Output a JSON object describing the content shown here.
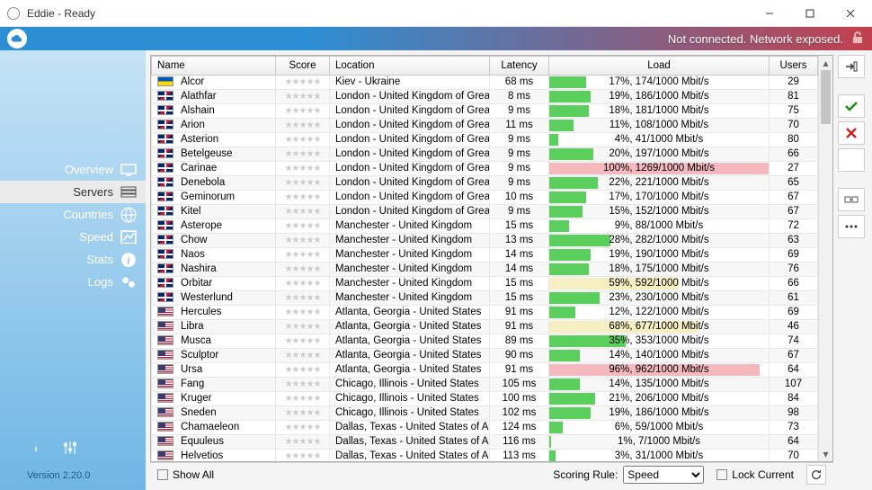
{
  "window": {
    "title": "Eddie - Ready"
  },
  "status": {
    "text": "Not connected. Network exposed."
  },
  "sidebar": {
    "items": [
      {
        "label": "Overview"
      },
      {
        "label": "Servers"
      },
      {
        "label": "Countries"
      },
      {
        "label": "Speed"
      },
      {
        "label": "Stats"
      },
      {
        "label": "Logs"
      }
    ],
    "version": "Version 2.20.0"
  },
  "table": {
    "headers": {
      "name": "Name",
      "score": "Score",
      "location": "Location",
      "latency": "Latency",
      "load": "Load",
      "users": "Users"
    },
    "rows": [
      {
        "flag": "ua",
        "name": "Alcor",
        "location": "Kiev - Ukraine",
        "latency": "68 ms",
        "load_pct": 17,
        "load_text": "17%, 174/1000 Mbit/s",
        "users": 29,
        "color": "green"
      },
      {
        "flag": "gb",
        "name": "Alathfar",
        "location": "London - United Kingdom of Great Britain",
        "latency": "8 ms",
        "load_pct": 19,
        "load_text": "19%, 186/1000 Mbit/s",
        "users": 81,
        "color": "green"
      },
      {
        "flag": "gb",
        "name": "Alshain",
        "location": "London - United Kingdom of Great Britain",
        "latency": "9 ms",
        "load_pct": 18,
        "load_text": "18%, 181/1000 Mbit/s",
        "users": 75,
        "color": "green"
      },
      {
        "flag": "gb",
        "name": "Arion",
        "location": "London - United Kingdom of Great Britain",
        "latency": "11 ms",
        "load_pct": 11,
        "load_text": "11%, 108/1000 Mbit/s",
        "users": 70,
        "color": "green"
      },
      {
        "flag": "gb",
        "name": "Asterion",
        "location": "London - United Kingdom of Great Britain",
        "latency": "9 ms",
        "load_pct": 4,
        "load_text": "4%, 41/1000 Mbit/s",
        "users": 80,
        "color": "green"
      },
      {
        "flag": "gb",
        "name": "Betelgeuse",
        "location": "London - United Kingdom of Great Britain",
        "latency": "9 ms",
        "load_pct": 20,
        "load_text": "20%, 197/1000 Mbit/s",
        "users": 66,
        "color": "green"
      },
      {
        "flag": "gb",
        "name": "Carinae",
        "location": "London - United Kingdom of Great Britain",
        "latency": "9 ms",
        "load_pct": 100,
        "load_text": "100%, 1269/1000 Mbit/s",
        "users": 27,
        "color": "red"
      },
      {
        "flag": "gb",
        "name": "Denebola",
        "location": "London - United Kingdom of Great Britain",
        "latency": "9 ms",
        "load_pct": 22,
        "load_text": "22%, 221/1000 Mbit/s",
        "users": 65,
        "color": "green"
      },
      {
        "flag": "gb",
        "name": "Geminorum",
        "location": "London - United Kingdom of Great Britain",
        "latency": "10 ms",
        "load_pct": 17,
        "load_text": "17%, 170/1000 Mbit/s",
        "users": 67,
        "color": "green"
      },
      {
        "flag": "gb",
        "name": "Kitel",
        "location": "London - United Kingdom of Great Britain",
        "latency": "9 ms",
        "load_pct": 15,
        "load_text": "15%, 152/1000 Mbit/s",
        "users": 67,
        "color": "green"
      },
      {
        "flag": "gb",
        "name": "Asterope",
        "location": "Manchester - United Kingdom",
        "latency": "15 ms",
        "load_pct": 9,
        "load_text": "9%, 88/1000 Mbit/s",
        "users": 72,
        "color": "green"
      },
      {
        "flag": "gb",
        "name": "Chow",
        "location": "Manchester - United Kingdom",
        "latency": "13 ms",
        "load_pct": 28,
        "load_text": "28%, 282/1000 Mbit/s",
        "users": 63,
        "color": "green"
      },
      {
        "flag": "gb",
        "name": "Naos",
        "location": "Manchester - United Kingdom",
        "latency": "14 ms",
        "load_pct": 19,
        "load_text": "19%, 190/1000 Mbit/s",
        "users": 69,
        "color": "green"
      },
      {
        "flag": "gb",
        "name": "Nashira",
        "location": "Manchester - United Kingdom",
        "latency": "14 ms",
        "load_pct": 18,
        "load_text": "18%, 175/1000 Mbit/s",
        "users": 76,
        "color": "green"
      },
      {
        "flag": "gb",
        "name": "Orbitar",
        "location": "Manchester - United Kingdom",
        "latency": "15 ms",
        "load_pct": 59,
        "load_text": "59%, 592/1000 Mbit/s",
        "users": 66,
        "color": "yellow"
      },
      {
        "flag": "gb",
        "name": "Westerlund",
        "location": "Manchester - United Kingdom",
        "latency": "15 ms",
        "load_pct": 23,
        "load_text": "23%, 230/1000 Mbit/s",
        "users": 61,
        "color": "green"
      },
      {
        "flag": "us",
        "name": "Hercules",
        "location": "Atlanta, Georgia - United States",
        "latency": "91 ms",
        "load_pct": 12,
        "load_text": "12%, 122/1000 Mbit/s",
        "users": 69,
        "color": "green"
      },
      {
        "flag": "us",
        "name": "Libra",
        "location": "Atlanta, Georgia - United States",
        "latency": "91 ms",
        "load_pct": 68,
        "load_text": "68%, 677/1000 Mbit/s",
        "users": 46,
        "color": "yellow"
      },
      {
        "flag": "us",
        "name": "Musca",
        "location": "Atlanta, Georgia - United States",
        "latency": "89 ms",
        "load_pct": 35,
        "load_text": "35%, 353/1000 Mbit/s",
        "users": 74,
        "color": "green"
      },
      {
        "flag": "us",
        "name": "Sculptor",
        "location": "Atlanta, Georgia - United States",
        "latency": "90 ms",
        "load_pct": 14,
        "load_text": "14%, 140/1000 Mbit/s",
        "users": 67,
        "color": "green"
      },
      {
        "flag": "us",
        "name": "Ursa",
        "location": "Atlanta, Georgia - United States",
        "latency": "91 ms",
        "load_pct": 96,
        "load_text": "96%, 962/1000 Mbit/s",
        "users": 64,
        "color": "red"
      },
      {
        "flag": "us",
        "name": "Fang",
        "location": "Chicago, Illinois - United States",
        "latency": "105 ms",
        "load_pct": 14,
        "load_text": "14%, 135/1000 Mbit/s",
        "users": 107,
        "color": "green"
      },
      {
        "flag": "us",
        "name": "Kruger",
        "location": "Chicago, Illinois - United States",
        "latency": "100 ms",
        "load_pct": 21,
        "load_text": "21%, 206/1000 Mbit/s",
        "users": 84,
        "color": "green"
      },
      {
        "flag": "us",
        "name": "Sneden",
        "location": "Chicago, Illinois - United States",
        "latency": "102 ms",
        "load_pct": 19,
        "load_text": "19%, 186/1000 Mbit/s",
        "users": 98,
        "color": "green"
      },
      {
        "flag": "us",
        "name": "Chamaeleon",
        "location": "Dallas, Texas - United States of America",
        "latency": "124 ms",
        "load_pct": 6,
        "load_text": "6%, 59/1000 Mbit/s",
        "users": 73,
        "color": "green"
      },
      {
        "flag": "us",
        "name": "Equuleus",
        "location": "Dallas, Texas - United States of America",
        "latency": "116 ms",
        "load_pct": 1,
        "load_text": "1%, 7/1000 Mbit/s",
        "users": 64,
        "color": "green"
      },
      {
        "flag": "us",
        "name": "Helvetios",
        "location": "Dallas, Texas - United States of America",
        "latency": "113 ms",
        "load_pct": 3,
        "load_text": "3%, 31/1000 Mbit/s",
        "users": 70,
        "color": "green"
      }
    ]
  },
  "footer": {
    "show_all": "Show All",
    "scoring_rule_label": "Scoring Rule:",
    "scoring_rule_value": "Speed",
    "lock_current": "Lock Current"
  }
}
